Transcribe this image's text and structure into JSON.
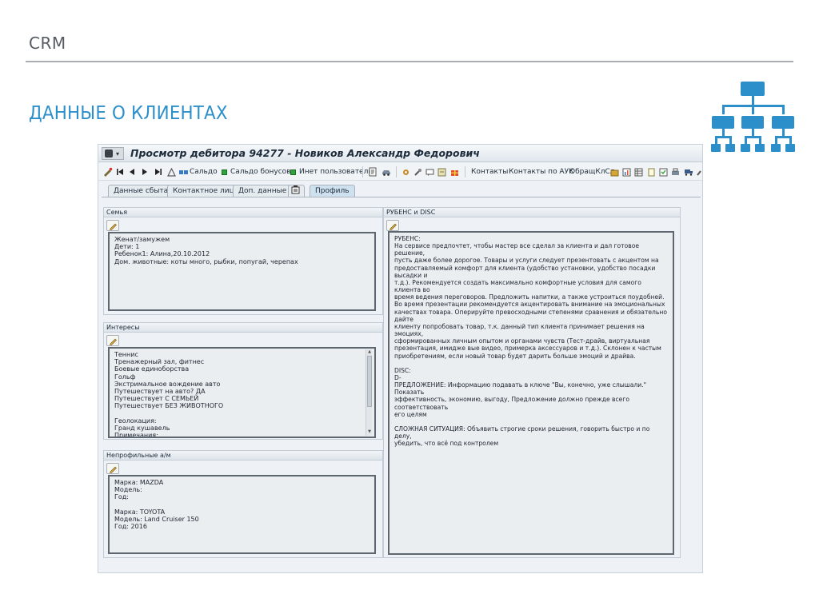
{
  "slide": {
    "header": "CRM",
    "title": "ДАННЫЕ О КЛИЕНТАХ"
  },
  "window": {
    "title": "Просмотр дебитора 94277 - Новиков Александр Федорович"
  },
  "toolbar": {
    "saldo": "Сальдо",
    "bonus_saldo": "Сальдо бонусов",
    "inet_user": "Инет пользователь",
    "contacts": "Контакты",
    "contacts_auk": "Контакты по АУК",
    "obrashch": "ОбращКлСл"
  },
  "tabs": [
    {
      "label": "Данные сбыта"
    },
    {
      "label": "Контактное лицо"
    },
    {
      "label": "Доп. данные"
    },
    {
      "label": "Профиль"
    }
  ],
  "panels": {
    "family": {
      "title": "Семья",
      "text": "Женат/замужем\nДети: 1\nРебенок1: Алина,20.10.2012\nДом. животные: коты много, рыбки, попугай, черепах"
    },
    "interests": {
      "title": "Интересы",
      "text": "Теннис\nТренажерный зал, фитнес\nБоевые единоборства\nГольф\nЭкстримальное вождение авто\nПутешествует на авто? ДА\nПутешествует С СЕМЬЕЙ\nПутешествует БЕЗ ЖИВОТНОГО\n\nГеолокация:\nГранд кушавель\nПримечания:"
    },
    "cars": {
      "title": "Непрофильные а/м",
      "text": "Марка: MAZDA\nМодель:\nГод:\n\nМарка: TOYOTA\nМодель: Land Cruiser 150\nГод: 2016"
    },
    "rubens": {
      "title": "РУБЕНС и DISC",
      "text": "РУБЕНС:\nНа сервисе предпочтет, чтобы мастер все сделал за клиента и дал готовое решение,\nпусть даже более дорогое. Товары и услуги следует презентовать с акцентом на\nпредоставляемый комфорт для клиента (удобство установки, удобство посадки высадки и\nт.д.). Рекомендуется создать максимально комфортные условия для самого клиента во\nвремя ведения переговоров. Предложить напитки, а также устроиться поудобней.\nВо время презентации рекомендуется акцентировать внимание на эмоциональных\nкачествах товара. Оперируйте превосходными степенями сравнения и обязательно дайте\nклиенту попробовать товар, т.к. данный тип клиента принимает решения на эмоциях,\nсформированных личным опытом и органами чувств (Тест-драйв, виртуальная\nпрезентация, имидже вые видео, примерка аксессуаров и т.д.). Склонен к частым\nприобретениям, если новый товар будет дарить больше эмоций и драйва.\n\nDISC:\nD-\nПРЕДЛОЖЕНИЕ: Информацию подавать в ключе \"Вы, конечно, уже слышали.\" Показать\nэффективность, экономию, выгоду, Предложение должно прежде всего соответствовать\nего целям\n\nСЛОЖНАЯ СИТУАЦИЯ: Объявить строгие сроки решения, говорить быстро и по делу,\nубедить, что всё под контролем"
    }
  },
  "colors": {
    "accent": "#2d8fca",
    "header_gray": "#555b61"
  }
}
